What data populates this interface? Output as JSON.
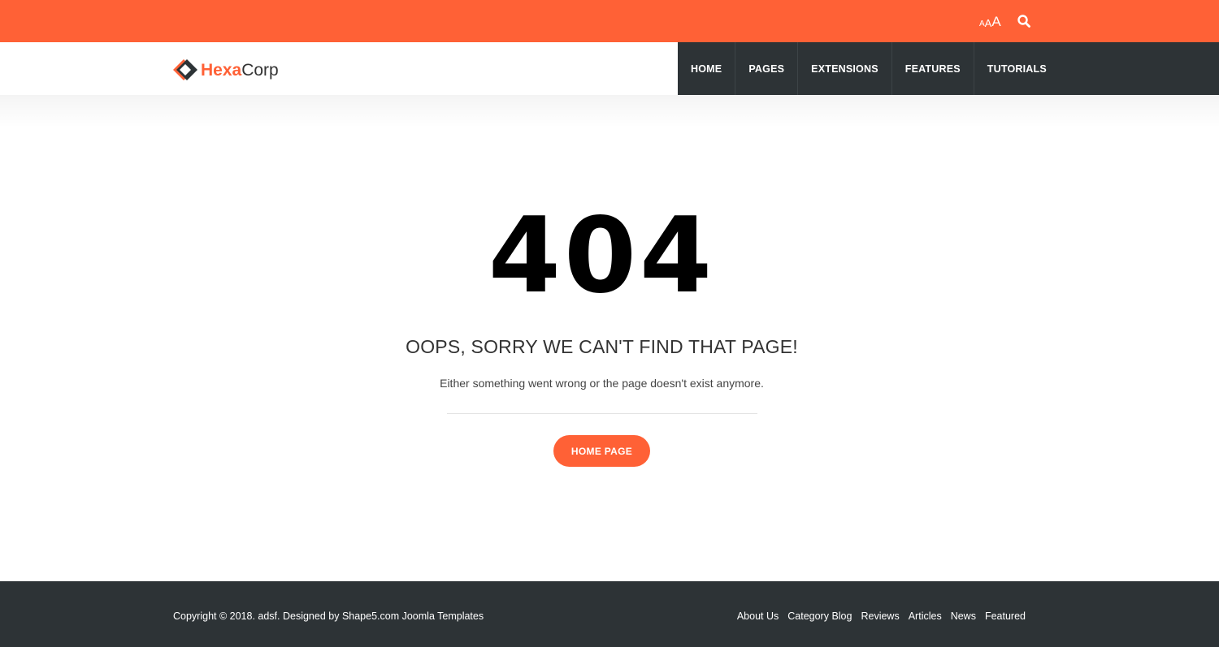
{
  "topbar": {
    "font_resizer": {
      "small": "A",
      "medium": "A",
      "large": "A"
    },
    "search_icon": "search-icon",
    "color": "#ff6136"
  },
  "header": {
    "logo": {
      "part1": "Hexa",
      "part2": "Corp",
      "icon": "hexagon-diamond-logo"
    },
    "nav": {
      "items": [
        {
          "label": "HOME"
        },
        {
          "label": "PAGES"
        },
        {
          "label": "EXTENSIONS"
        },
        {
          "label": "FEATURES"
        },
        {
          "label": "TUTORIALS"
        }
      ],
      "background": "#2d3336"
    }
  },
  "main": {
    "error_code": "404",
    "heading": "OOPS, SORRY WE CAN'T FIND THAT PAGE!",
    "description": "Either something went wrong or the page doesn't exist anymore.",
    "button_label": "HOME PAGE",
    "accent": "#ff6136"
  },
  "footer": {
    "copyright": "Copyright © 2018. adsf. Designed by Shape5.com Joomla Templates",
    "links": [
      {
        "label": "About Us"
      },
      {
        "label": "Category Blog"
      },
      {
        "label": "Reviews"
      },
      {
        "label": "Articles"
      },
      {
        "label": "News"
      },
      {
        "label": "Featured"
      }
    ],
    "background": "#2d3336"
  }
}
